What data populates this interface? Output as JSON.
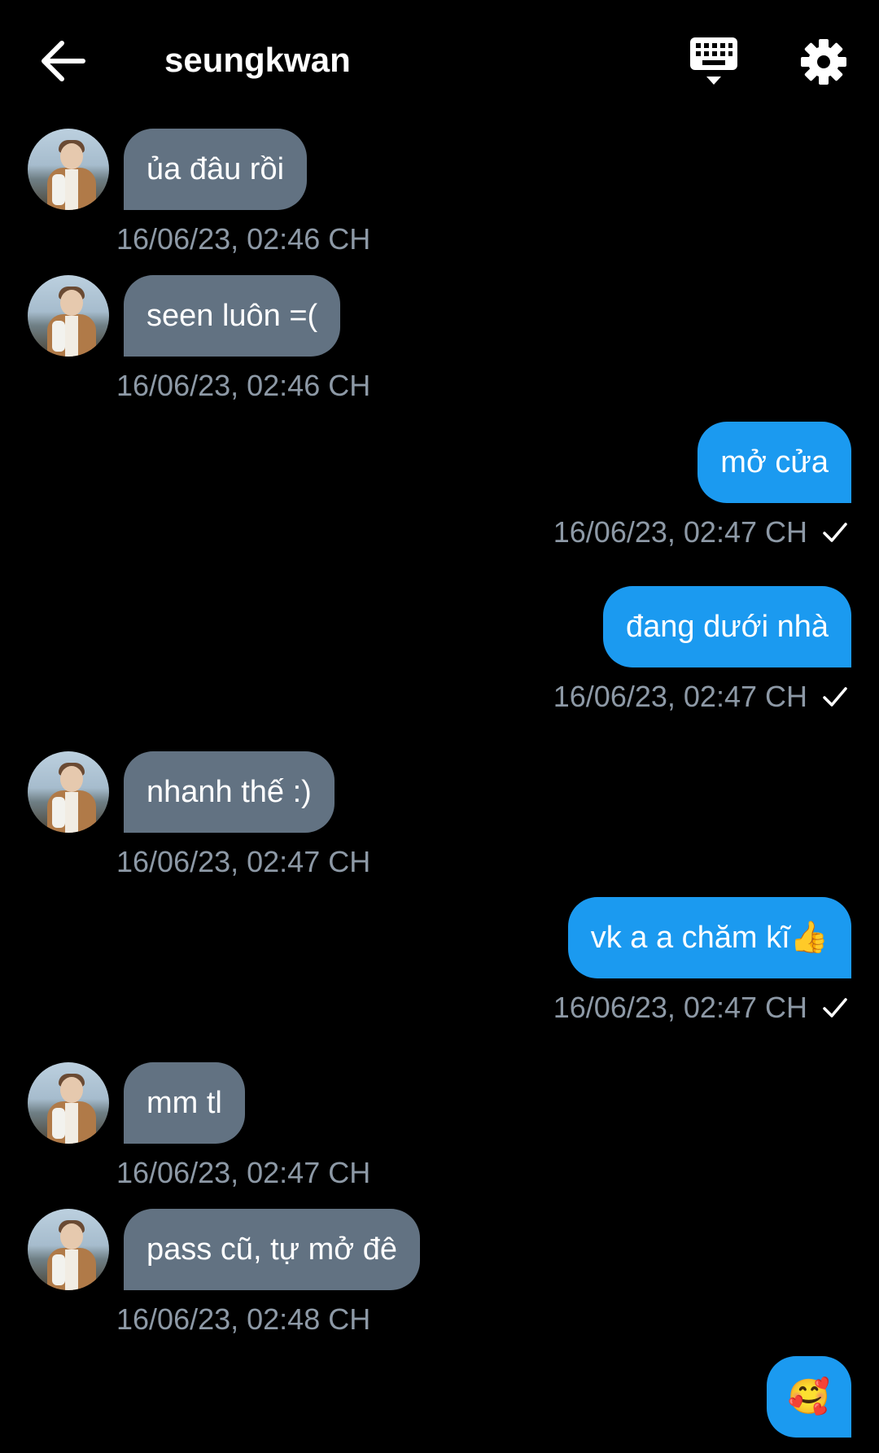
{
  "header": {
    "title": "seungkwan",
    "back_icon": "arrow-left-icon",
    "keyboard_icon": "keyboard-icon",
    "settings_icon": "gear-icon"
  },
  "colors": {
    "background": "#000000",
    "incoming_bubble": "#627282",
    "outgoing_bubble": "#1b9af0",
    "timestamp": "#8d99a6"
  },
  "messages": [
    {
      "direction": "incoming",
      "text": "ủa đâu rồi",
      "time": "16/06/23, 02:46 CH"
    },
    {
      "direction": "incoming",
      "text": "seen luôn =(",
      "time": "16/06/23, 02:46 CH"
    },
    {
      "direction": "outgoing",
      "text": "mở cửa",
      "time": "16/06/23, 02:47 CH",
      "status": "sent"
    },
    {
      "direction": "outgoing",
      "text": "đang dưới nhà",
      "time": "16/06/23, 02:47 CH",
      "status": "sent"
    },
    {
      "direction": "incoming",
      "text": "nhanh thế :)",
      "time": "16/06/23, 02:47 CH"
    },
    {
      "direction": "outgoing",
      "text": "vk a a chăm kĩ👍",
      "time": "16/06/23, 02:47 CH",
      "status": "sent"
    },
    {
      "direction": "incoming",
      "text": "mm tl",
      "time": "16/06/23, 02:47 CH"
    },
    {
      "direction": "incoming",
      "text": "pass cũ, tự mở đê",
      "time": "16/06/23, 02:48 CH"
    },
    {
      "direction": "outgoing",
      "text": "🥰",
      "time": "",
      "status": ""
    }
  ]
}
